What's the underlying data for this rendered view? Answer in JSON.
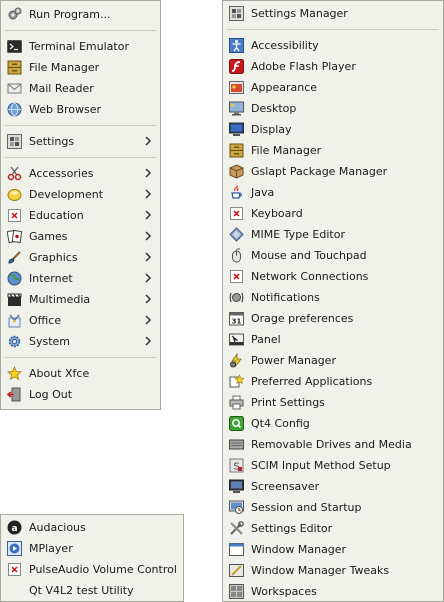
{
  "main_menu": {
    "run": "Run Program...",
    "terminal": "Terminal Emulator",
    "file_manager": "File Manager",
    "mail_reader": "Mail Reader",
    "web_browser": "Web Browser",
    "settings": "Settings",
    "accessories": "Accessories",
    "development": "Development",
    "education": "Education",
    "games": "Games",
    "graphics": "Graphics",
    "internet": "Internet",
    "multimedia": "Multimedia",
    "office": "Office",
    "system": "System",
    "about": "About Xfce",
    "logout": "Log Out"
  },
  "settings_menu": {
    "header": "Settings Manager",
    "items": [
      "Accessibility",
      "Adobe Flash Player",
      "Appearance",
      "Desktop",
      "Display",
      "File Manager",
      "Gslapt Package Manager",
      "Java",
      "Keyboard",
      "MIME Type Editor",
      "Mouse and Touchpad",
      "Network Connections",
      "Notifications",
      "Orage preferences",
      "Panel",
      "Power Manager",
      "Preferred Applications",
      "Print Settings",
      "Qt4 Config",
      "Removable Drives and Media",
      "SCIM Input Method Setup",
      "Screensaver",
      "Session and Startup",
      "Settings Editor",
      "Window Manager",
      "Window Manager Tweaks",
      "Workspaces"
    ]
  },
  "multimedia_menu": {
    "items": [
      "Audacious",
      "MPlayer",
      "PulseAudio Volume Control",
      "Qt V4L2 test Utility"
    ]
  },
  "orage_icon_text": "31"
}
